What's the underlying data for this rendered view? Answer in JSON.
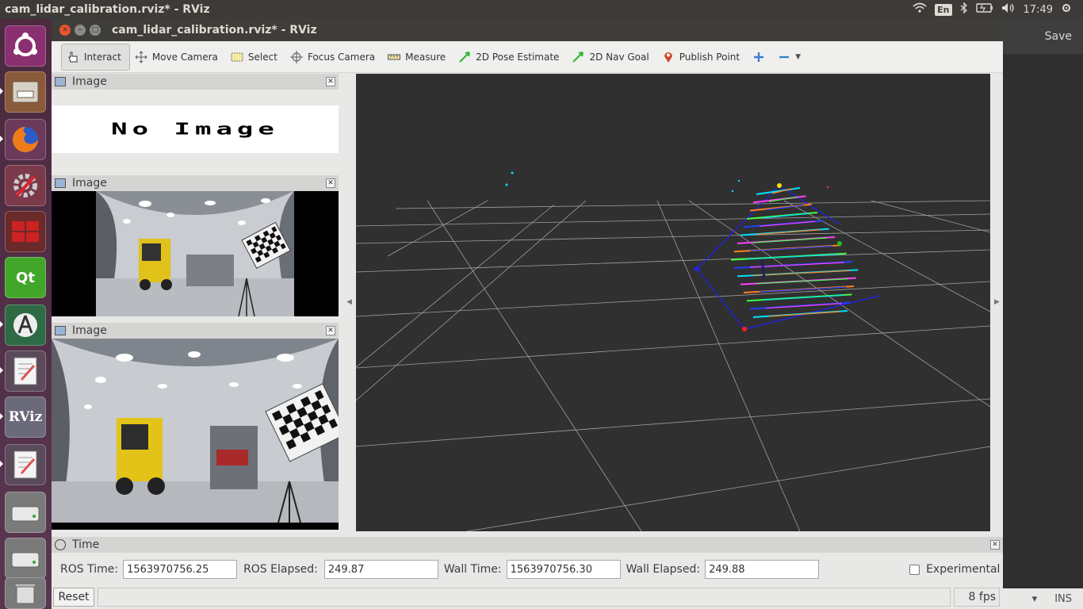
{
  "system": {
    "active_window_title": "cam_lidar_calibration.rviz* - RViz",
    "keyboard_layout": "En",
    "clock": "17:49"
  },
  "launcher": {
    "items": [
      "ubuntu-logo",
      "files",
      "firefox",
      "system-settings",
      "workspace-switcher",
      "qt-creator",
      "software-updater",
      "text-editor",
      "rviz",
      "text-editor-2",
      "drive",
      "drive-2",
      "trash"
    ]
  },
  "window": {
    "title": "cam_lidar_calibration.rviz* - RViz"
  },
  "toolbar": {
    "interact": "Interact",
    "move_camera": "Move Camera",
    "select": "Select",
    "focus_camera": "Focus Camera",
    "measure": "Measure",
    "pose_estimate": "2D Pose Estimate",
    "nav_goal": "2D Nav Goal",
    "publish_point": "Publish Point"
  },
  "panels": {
    "image1": {
      "title": "Image",
      "placeholder": "No Image"
    },
    "image2": {
      "title": "Image"
    },
    "image3": {
      "title": "Image"
    }
  },
  "time": {
    "title": "Time",
    "ros_time_label": "ROS Time:",
    "ros_time": "1563970756.25",
    "ros_elapsed_label": "ROS Elapsed:",
    "ros_elapsed": "249.87",
    "wall_time_label": "Wall Time:",
    "wall_time": "1563970756.30",
    "wall_elapsed_label": "Wall Elapsed:",
    "wall_elapsed": "249.88",
    "experimental_label": "Experimental",
    "reset_label": "Reset",
    "fps": "8 fps"
  },
  "background_window": {
    "save_label": "Save",
    "mode": "INS"
  },
  "colors": {
    "launcher_bg": "#4e2d45",
    "view_bg": "#303030",
    "grid": "#a0a0a0",
    "lidar_cyan": "#00e0ff",
    "lidar_magenta": "#ff40ff",
    "lidar_orange": "#ff8020",
    "board_outline": "#2020ff"
  }
}
